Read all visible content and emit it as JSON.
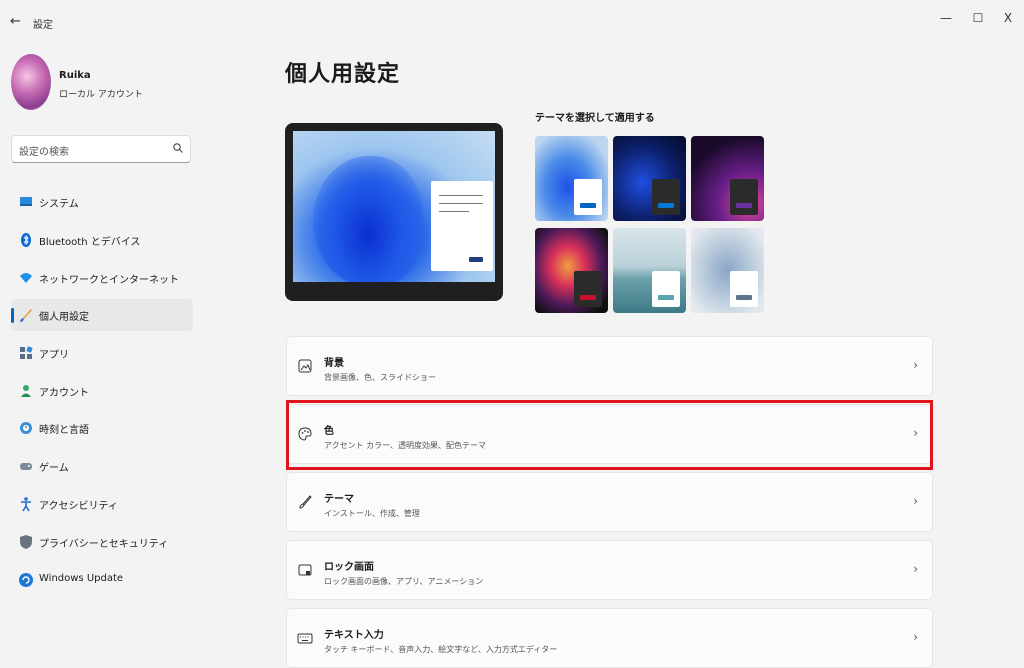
{
  "window": {
    "title": "設定",
    "back_icon": "back-arrow-icon",
    "minimize": "—",
    "maximize": "☐",
    "close": "X"
  },
  "user": {
    "name": "Ruika",
    "account_type": "ローカル アカウント"
  },
  "search": {
    "placeholder": "設定の検索"
  },
  "sidebar": {
    "items": [
      {
        "label": "システム",
        "icon": "system-icon"
      },
      {
        "label": "Bluetooth とデバイス",
        "icon": "bluetooth-icon"
      },
      {
        "label": "ネットワークとインターネット",
        "icon": "network-icon"
      },
      {
        "label": "個人用設定",
        "icon": "personalization-brush-icon",
        "selected": true
      },
      {
        "label": "アプリ",
        "icon": "apps-icon"
      },
      {
        "label": "アカウント",
        "icon": "account-icon"
      },
      {
        "label": "時刻と言語",
        "icon": "time-language-icon"
      },
      {
        "label": "ゲーム",
        "icon": "gaming-icon"
      },
      {
        "label": "アクセシビリティ",
        "icon": "accessibility-icon"
      },
      {
        "label": "プライバシーとセキュリティ",
        "icon": "privacy-shield-icon"
      },
      {
        "label": "Windows Update",
        "icon": "windows-update-icon"
      }
    ]
  },
  "main": {
    "title": "個人用設定",
    "theme_heading": "テーマを選択して適用する",
    "themes": [
      {
        "name": "windows-light",
        "accent": "#0067c0"
      },
      {
        "name": "windows-dark",
        "accent": "#0078d4"
      },
      {
        "name": "glow",
        "accent": "#6b2fa0"
      },
      {
        "name": "captured-motion",
        "accent": "#c8102e"
      },
      {
        "name": "sunrise",
        "accent": "#5aa3b0"
      },
      {
        "name": "flow",
        "accent": "#5f7488"
      }
    ],
    "cards": [
      {
        "title": "背景",
        "subtitle": "背景画像、色、スライドショー",
        "icon": "picture-icon"
      },
      {
        "title": "色",
        "subtitle": "アクセント カラー、透明度効果、配色テーマ",
        "icon": "palette-icon",
        "highlighted": true
      },
      {
        "title": "テーマ",
        "subtitle": "インストール、作成、管理",
        "icon": "brush-icon"
      },
      {
        "title": "ロック画面",
        "subtitle": "ロック画面の画像、アプリ、アニメーション",
        "icon": "lock-screen-icon"
      },
      {
        "title": "テキスト入力",
        "subtitle": "タッチ キーボード、音声入力、絵文字など、入力方式エディター",
        "icon": "keyboard-icon"
      }
    ],
    "chevron": "›"
  },
  "colors": {
    "accent": "#0067c0",
    "highlight_border": "#e0141e"
  }
}
